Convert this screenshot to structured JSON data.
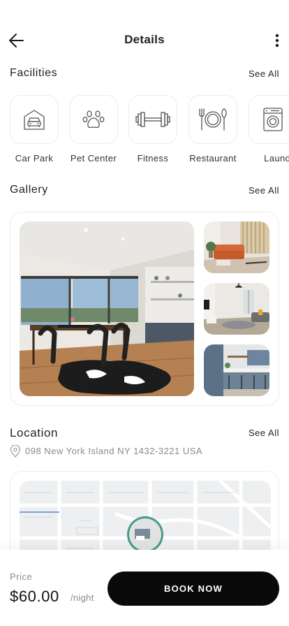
{
  "header": {
    "title": "Details",
    "back_icon": "arrow-left-icon",
    "more_icon": "more-vertical-icon"
  },
  "facilities": {
    "title": "Facilities",
    "see_all": "See All",
    "items": [
      {
        "label": "Car Park",
        "icon": "garage-car-icon"
      },
      {
        "label": "Pet Center",
        "icon": "paw-icon"
      },
      {
        "label": "Fitness",
        "icon": "dumbbell-icon"
      },
      {
        "label": "Restaurant",
        "icon": "fork-plate-spoon-icon"
      },
      {
        "label": "Laundry",
        "icon": "washing-machine-icon"
      }
    ]
  },
  "gallery": {
    "title": "Gallery",
    "see_all": "See All",
    "photos": [
      "dining-room-photo",
      "living-room-orange-sofa-photo",
      "living-room-grey-sofa-photo",
      "kitchen-blue-cabinets-photo"
    ]
  },
  "location": {
    "title": "Location",
    "see_all": "See All",
    "address": "098 New York Island NY 1432-3221 USA",
    "pin_icon": "map-pin-icon"
  },
  "booking": {
    "price_caption": "Price",
    "price": "$60.00",
    "unit": "/night",
    "button": "BOOK NOW"
  },
  "colors": {
    "accent": "#0a0a0a",
    "muted_text": "#8a8a8a",
    "map_marker_ring": "#4a9a88"
  }
}
